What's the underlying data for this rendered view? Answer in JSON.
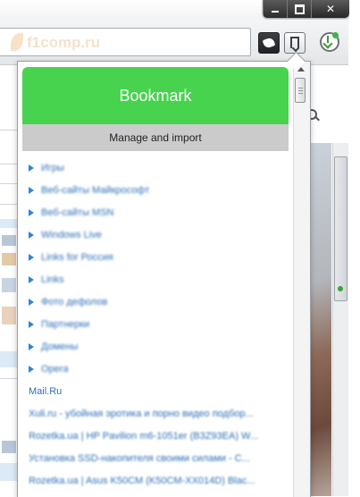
{
  "browser": {
    "site_logo_text": "f1comp.ru",
    "window_controls": [
      "minimize",
      "maximize",
      "close"
    ]
  },
  "bookmarks_popup": {
    "title": "Bookmark",
    "manage_label": "Manage and import",
    "header_color": "#47d34d",
    "folders": [
      {
        "label": "Игры"
      },
      {
        "label": "Веб-сайты Майкрософт"
      },
      {
        "label": "Веб-сайты MSN"
      },
      {
        "label": "Windows Live"
      },
      {
        "label": "Links for Россия"
      },
      {
        "label": "Links"
      },
      {
        "label": "Фото дефолов"
      },
      {
        "label": "Партнерки"
      },
      {
        "label": "Домены"
      },
      {
        "label": "Opera"
      }
    ],
    "links": [
      {
        "label": "Mail.Ru",
        "blurred": false
      },
      {
        "label": "Xuli.ru - убойная эротика и порно видео подбор...",
        "blurred": true
      },
      {
        "label": "Rozetka.ua | HP Pavilion m6-1051er (B3Z93EA) W...",
        "blurred": true
      },
      {
        "label": "Установка SSD-накопителя своими силами - C...",
        "blurred": true
      },
      {
        "label": "Rozetka.ua | Asus K50CM (K50CM-XX014D) Blac...",
        "blurred": true
      }
    ]
  },
  "icons": {
    "extension": "extension-icon",
    "bookmark": "bookmark-icon",
    "download": "download-icon"
  }
}
